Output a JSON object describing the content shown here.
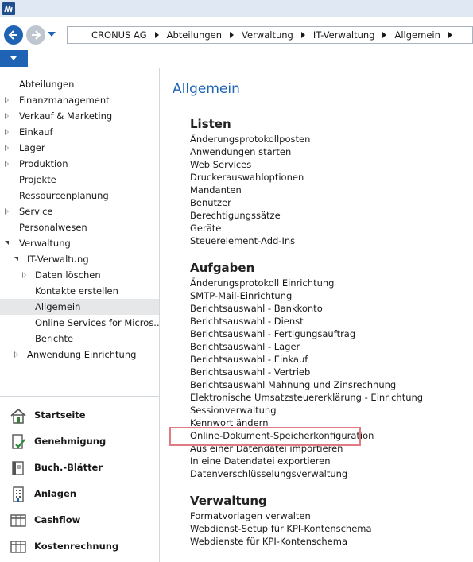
{
  "app": {
    "logo_icon": "dynamics-nav-logo-icon",
    "accent_color": "#1f64b4"
  },
  "navigation": {
    "back_icon": "arrow-left-icon",
    "forward_icon": "arrow-right-icon",
    "history_icon": "chevron-down-icon",
    "breadcrumbs": [
      "CRONUS AG",
      "Abteilungen",
      "Verwaltung",
      "IT-Verwaltung",
      "Allgemein"
    ]
  },
  "menu": {
    "icon": "chevron-down-icon"
  },
  "sidebar": {
    "tree": [
      {
        "label": "Abteilungen",
        "level": 0,
        "toggle": "none"
      },
      {
        "label": "Finanzmanagement",
        "level": 0,
        "toggle": "collapsed"
      },
      {
        "label": "Verkauf & Marketing",
        "level": 0,
        "toggle": "collapsed"
      },
      {
        "label": "Einkauf",
        "level": 0,
        "toggle": "collapsed"
      },
      {
        "label": "Lager",
        "level": 0,
        "toggle": "collapsed"
      },
      {
        "label": "Produktion",
        "level": 0,
        "toggle": "collapsed"
      },
      {
        "label": "Projekte",
        "level": 0,
        "toggle": "none"
      },
      {
        "label": "Ressourcenplanung",
        "level": 0,
        "toggle": "none"
      },
      {
        "label": "Service",
        "level": 0,
        "toggle": "collapsed"
      },
      {
        "label": "Personalwesen",
        "level": 0,
        "toggle": "none"
      },
      {
        "label": "Verwaltung",
        "level": 0,
        "toggle": "expanded"
      },
      {
        "label": "IT-Verwaltung",
        "level": 1,
        "toggle": "expanded"
      },
      {
        "label": "Daten löschen",
        "level": 2,
        "toggle": "collapsed"
      },
      {
        "label": "Kontakte erstellen",
        "level": 2,
        "toggle": "none"
      },
      {
        "label": "Allgemein",
        "level": 2,
        "toggle": "none",
        "selected": true
      },
      {
        "label": "Online Services for Micros...",
        "level": 2,
        "toggle": "none"
      },
      {
        "label": "Berichte",
        "level": 2,
        "toggle": "none"
      },
      {
        "label": "Anwendung Einrichtung",
        "level": 1,
        "toggle": "collapsed"
      }
    ],
    "buttons": [
      {
        "label": "Startseite",
        "icon": "house-icon"
      },
      {
        "label": "Genehmigung",
        "icon": "document-check-icon"
      },
      {
        "label": "Buch.-Blätter",
        "icon": "journal-book-icon"
      },
      {
        "label": "Anlagen",
        "icon": "building-icon"
      },
      {
        "label": "Cashflow",
        "icon": "ledger-table-icon"
      },
      {
        "label": "Kostenrechnung",
        "icon": "ledger-table-icon"
      }
    ]
  },
  "main": {
    "title": "Allgemein",
    "sections": [
      {
        "title": "Listen",
        "items": [
          "Änderungsprotokollposten",
          "Anwendungen starten",
          "Web Services",
          "Druckerauswahloptionen",
          "Mandanten",
          "Benutzer",
          "Berechtigungssätze",
          "Geräte",
          "Steuerelement-Add-Ins"
        ]
      },
      {
        "title": "Aufgaben",
        "items": [
          "Änderungsprotokoll Einrichtung",
          "SMTP-Mail-Einrichtung",
          "Berichtsauswahl - Bankkonto",
          "Berichtsauswahl - Dienst",
          "Berichtsauswahl - Fertigungsauftrag",
          "Berichtsauswahl - Lager",
          "Berichtsauswahl - Einkauf",
          "Berichtsauswahl - Vertrieb",
          "Berichtsauswahl Mahnung und Zinsrechnung",
          "Elektronische Umsatzsteuererklärung - Einrichtung",
          "Sessionverwaltung",
          "Kennwort ändern",
          "Online-Dokument-Speicherkonfiguration",
          "Aus einer Datendatei importieren",
          "In eine Datendatei exportieren",
          "Datenverschlüsselungsverwaltung"
        ]
      },
      {
        "title": "Verwaltung",
        "items": [
          "Formatvorlagen verwalten",
          "Webdienst-Setup für KPI-Kontenschema",
          "Webdienste für KPI-Kontenschema"
        ]
      }
    ],
    "highlight_color": "#e07a83"
  }
}
